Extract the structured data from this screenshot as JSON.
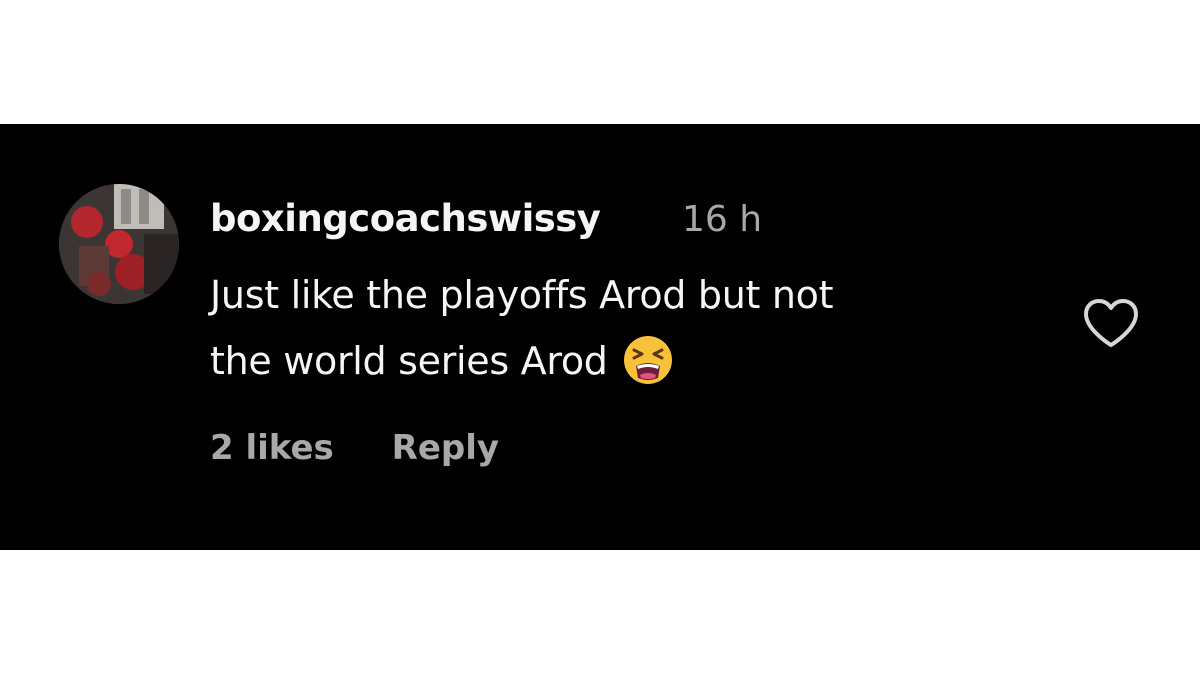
{
  "comment": {
    "username": "boxingcoachswissy",
    "timestamp": "16 h",
    "text_line_1": "Just like the playoffs Arod but not",
    "text_line_2": "the world series Arod",
    "emoji": "tired-face-emoji",
    "likes": "2 likes",
    "reply_label": "Reply",
    "like_icon": "heart-outline-icon"
  },
  "colors": {
    "background": "#000000",
    "primary_text": "#f5f5f5",
    "secondary_text": "#a8a8a8"
  }
}
